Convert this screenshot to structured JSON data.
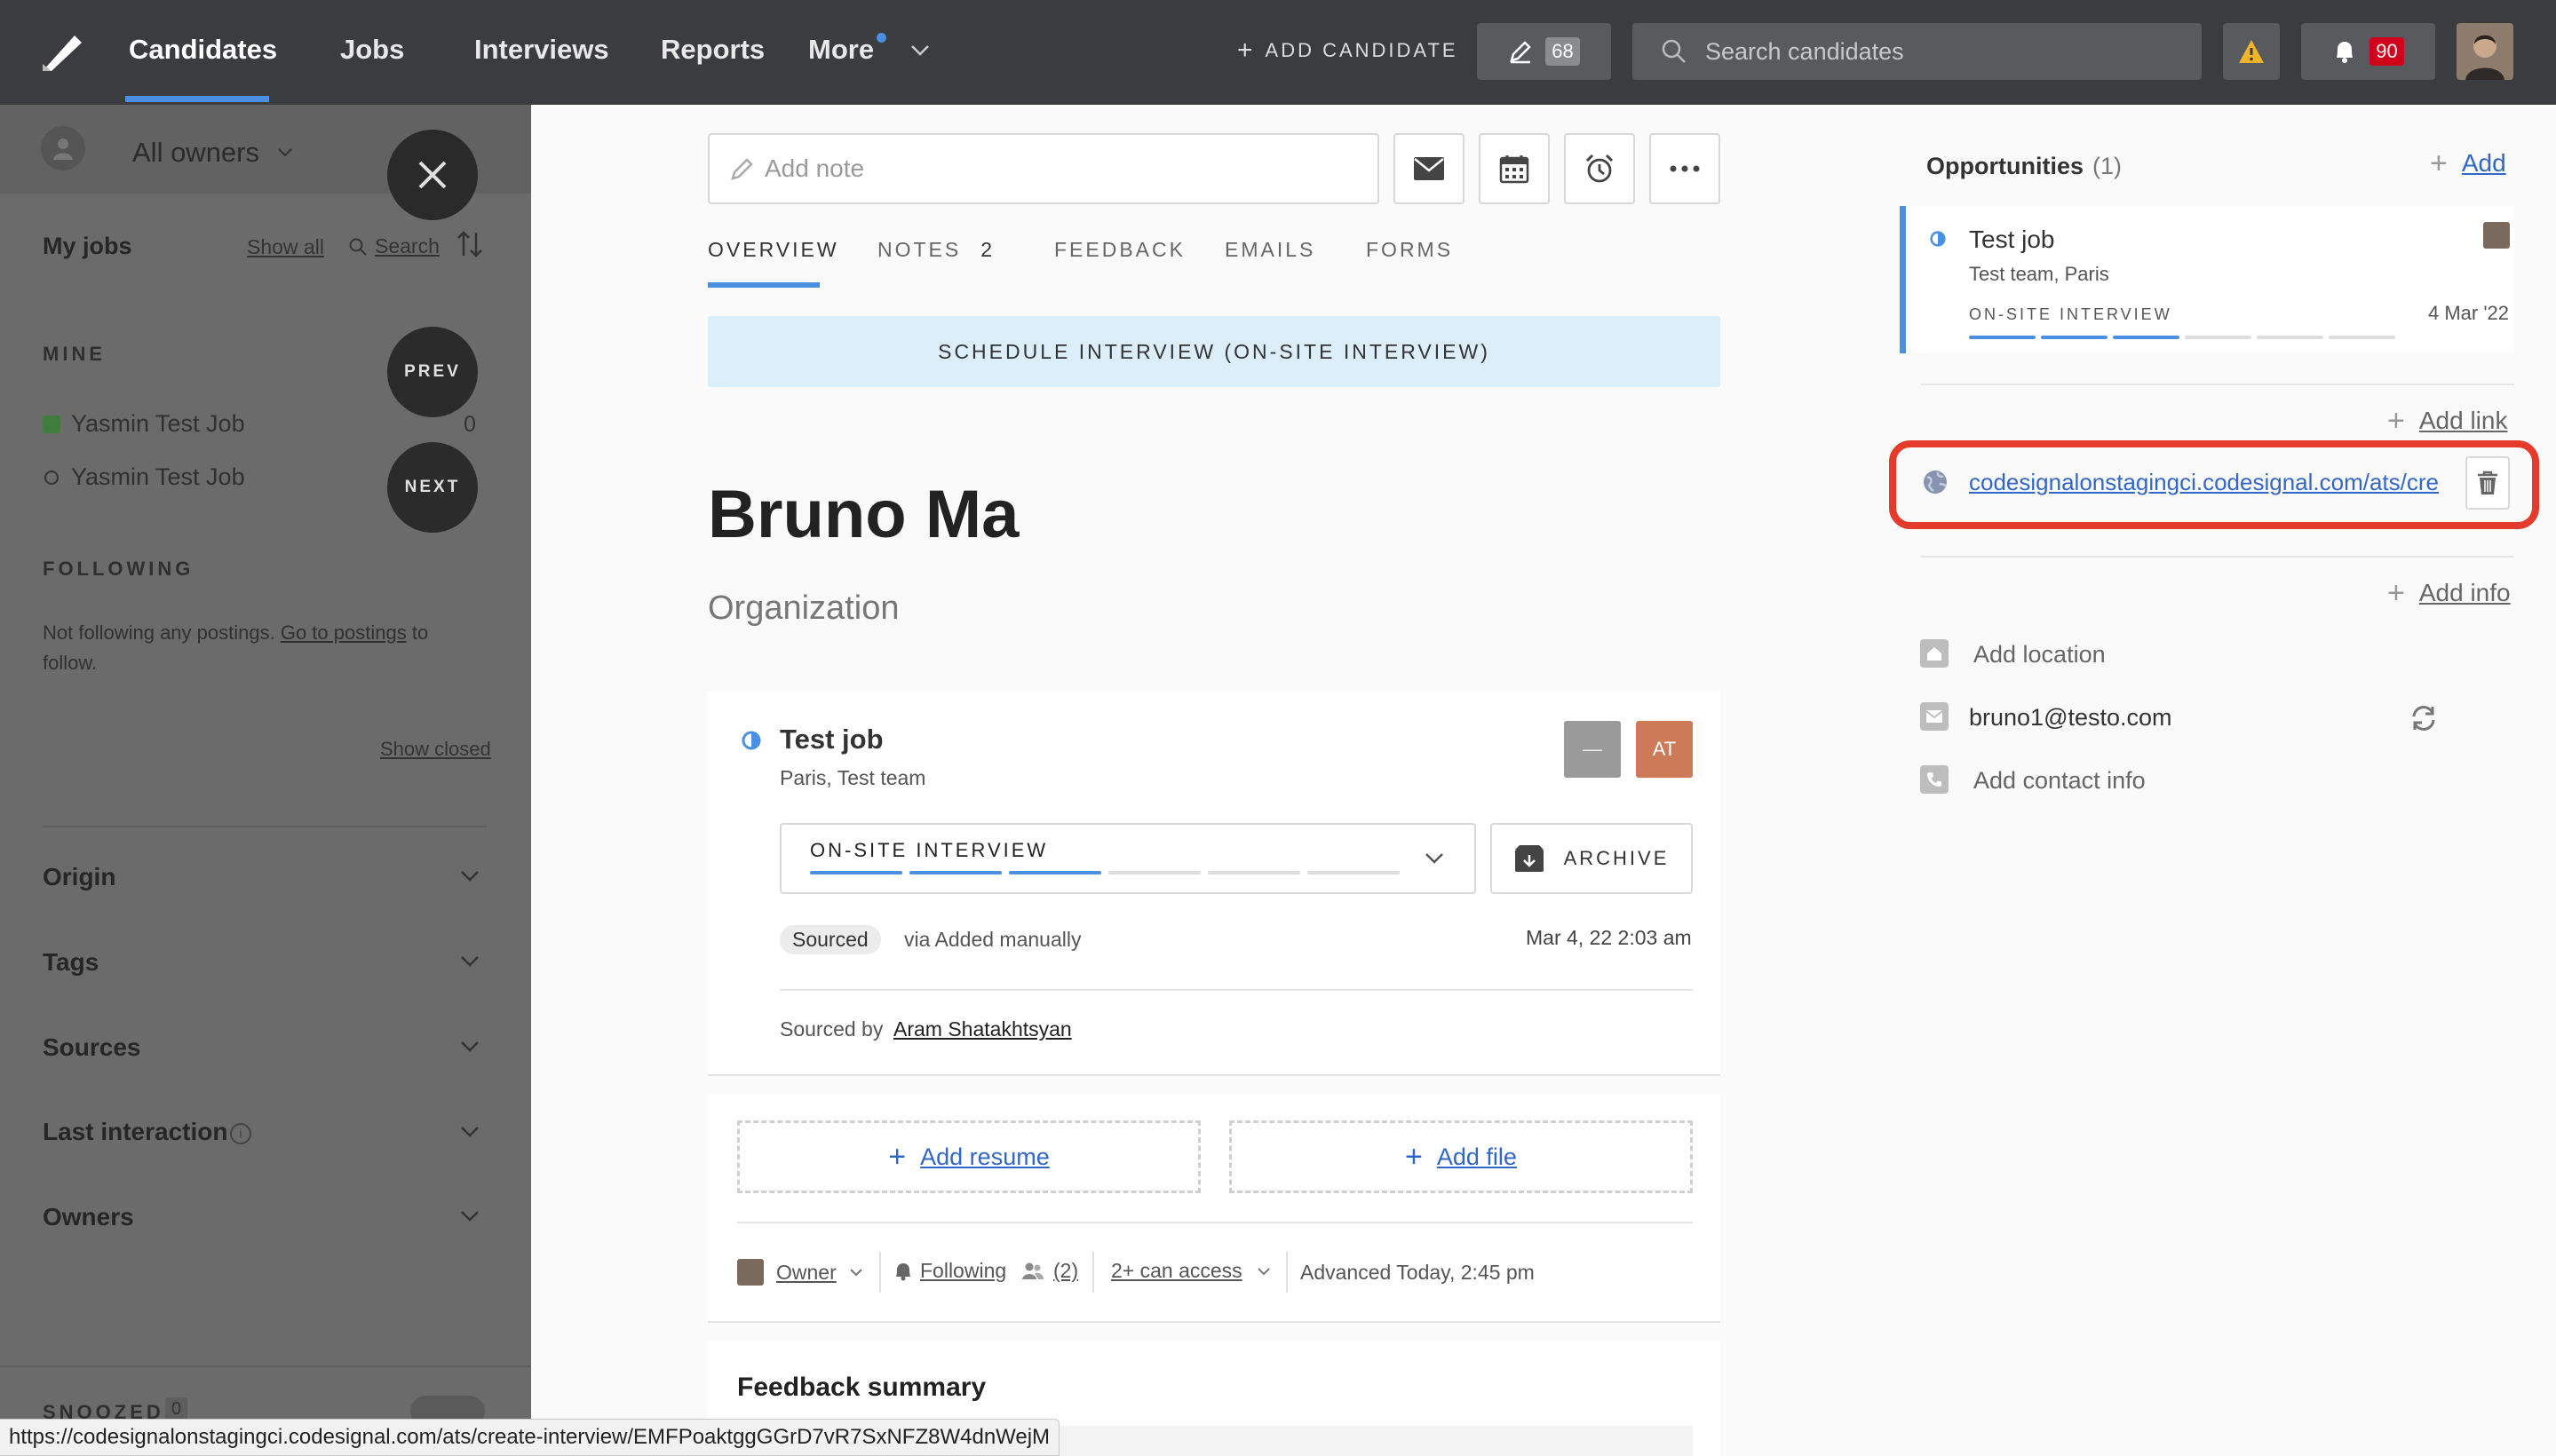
{
  "nav": {
    "candidates": "Candidates",
    "jobs": "Jobs",
    "interviews": "Interviews",
    "reports": "Reports",
    "more": "More",
    "add_candidate": "ADD CANDIDATE",
    "edit_count": "68",
    "search_placeholder": "Search candidates",
    "notifications_count": "90"
  },
  "sidebar": {
    "owners": "All owners",
    "my_jobs": "My jobs",
    "show_all": "Show all",
    "search": "Search",
    "mine": "MINE",
    "prev": "PREV",
    "next": "NEXT",
    "jobs": [
      {
        "name": "Yasmin Test Job",
        "count": "0"
      },
      {
        "name": "Yasmin Test Job",
        "count": ""
      }
    ],
    "following": "FOLLOWING",
    "following_text_1": "Not following any postings.",
    "following_link": "Go to postings",
    "following_text_2": "to",
    "following_text_3": "follow.",
    "show_closed": "Show closed",
    "sections": [
      "Origin",
      "Tags",
      "Sources",
      "Last interaction",
      "Owners"
    ],
    "snoozed": "SNOOZED",
    "snoozed_count": "0"
  },
  "main": {
    "note_placeholder": "Add note",
    "tabs": [
      {
        "label": "OVERVIEW"
      },
      {
        "label": "NOTES",
        "count": "2"
      },
      {
        "label": "FEEDBACK"
      },
      {
        "label": "EMAILS"
      },
      {
        "label": "FORMS"
      }
    ],
    "schedule_label": "SCHEDULE INTERVIEW (ON-SITE INTERVIEW)",
    "candidate_name": "Bruno Ma",
    "organization": "Organization",
    "job": {
      "title": "Test job",
      "subtitle": "Paris, Test team",
      "badge_a": "—",
      "badge_b": "AT",
      "stage": "ON-SITE INTERVIEW",
      "stage_progress_filled": 3,
      "stage_progress_total": 6,
      "archive": "ARCHIVE",
      "source_tag": "Sourced",
      "source_via": "via Added manually",
      "date": "Mar 4, 22 2:03 am",
      "sourced_by_label": "Sourced by",
      "sourced_by": "Aram Shatakhtsyan"
    },
    "add_resume": "Add resume",
    "add_file": "Add file",
    "owner": "Owner",
    "following": "Following",
    "followers": "(2)",
    "can_access": "2+ can access",
    "advanced": "Advanced Today, 2:45 pm",
    "feedback_summary": "Feedback summary"
  },
  "right": {
    "opportunities": "Opportunities",
    "opp_count": "(1)",
    "add": "Add",
    "opp": {
      "title": "Test job",
      "subtitle": "Test team, Paris",
      "stage": "ON-SITE INTERVIEW",
      "date": "4 Mar '22"
    },
    "add_link": "Add link",
    "link_url": "codesignalonstagingci.codesignal.com/ats/cre",
    "add_info": "Add info",
    "add_location": "Add location",
    "email": "bruno1@testo.com",
    "add_contact": "Add contact info"
  },
  "status_url": "https://codesignalonstagingci.codesignal.com/ats/create-interview/EMFPoaktggGGrD7vR7SxNFZ8W4dnWejM",
  "colors": {
    "accent": "#4a90e2",
    "highlight": "#e53b2c",
    "nav_bg": "#3b3c3f",
    "warning": "#f0b429",
    "badge_red": "#d0021b"
  }
}
